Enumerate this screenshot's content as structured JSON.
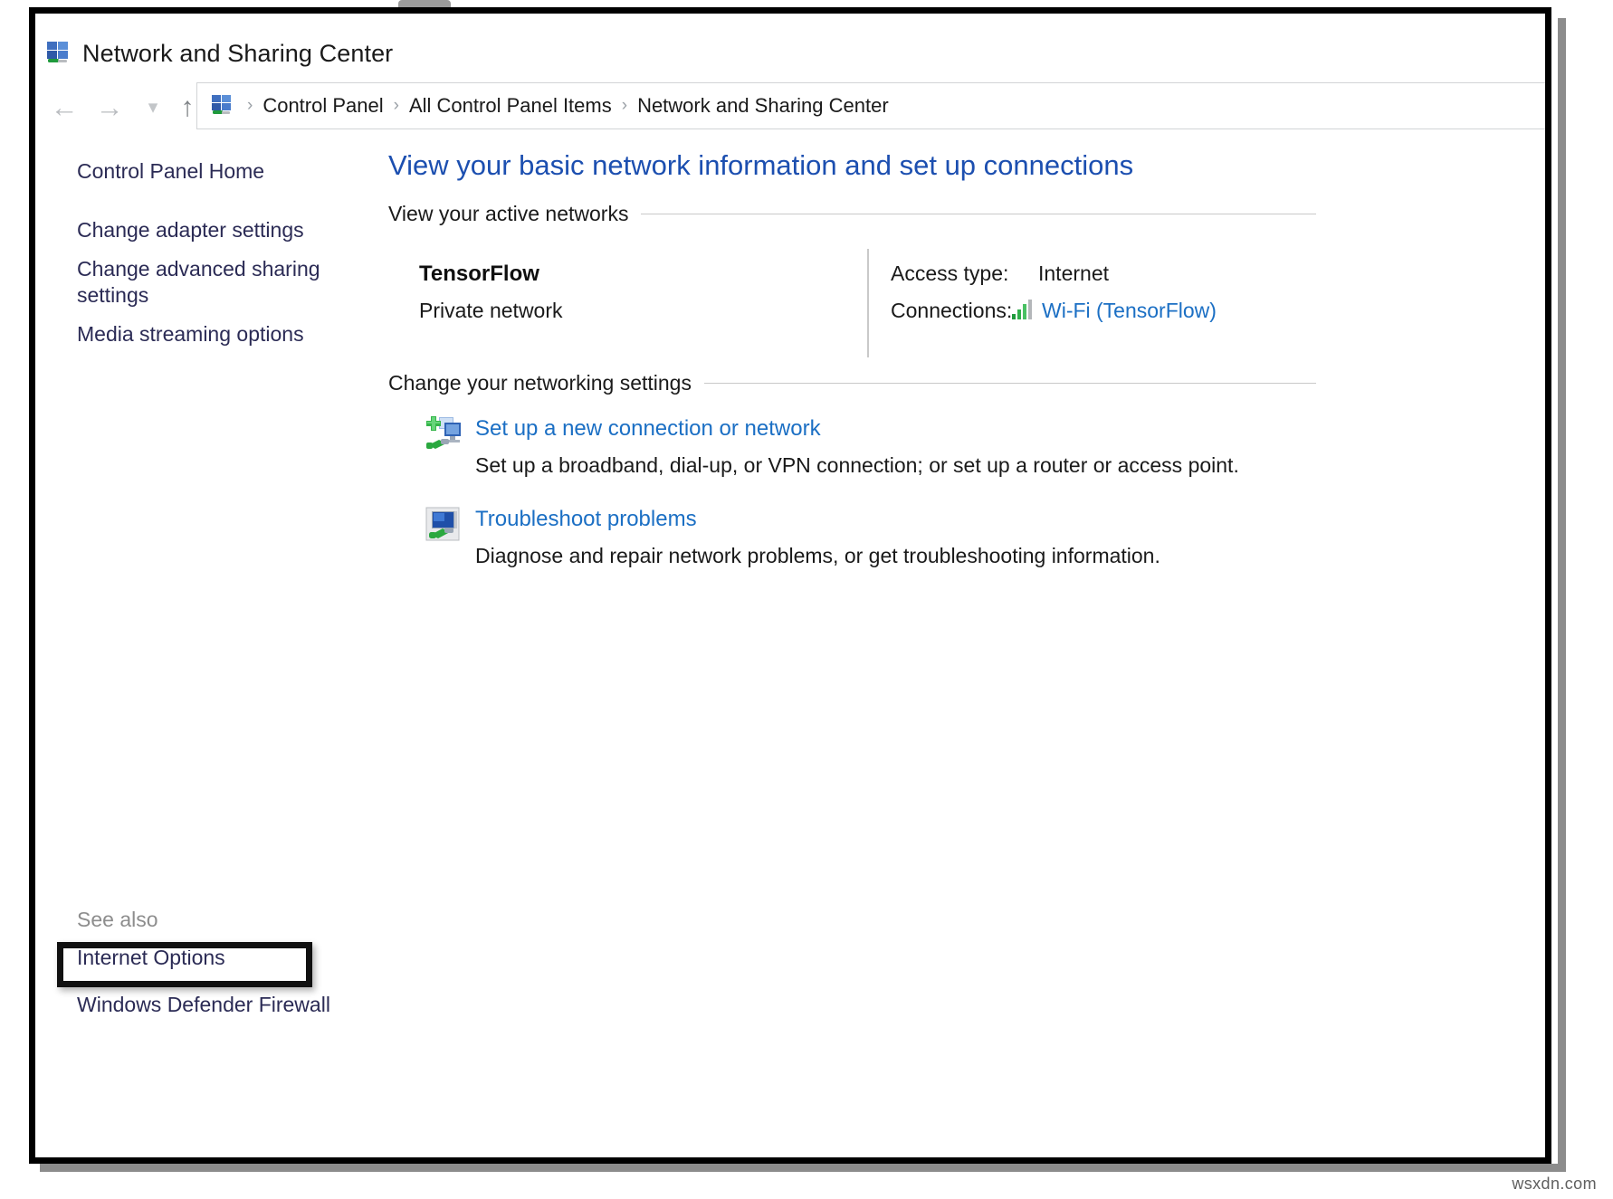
{
  "window": {
    "title": "Network and Sharing Center",
    "icon": "network-sharing-icon"
  },
  "navigation": {
    "back_icon": "arrow-left-icon",
    "forward_icon": "arrow-right-icon",
    "recent_icon": "chevron-down-icon",
    "up_icon": "arrow-up-icon",
    "breadcrumb_icon": "network-sharing-icon",
    "breadcrumb": [
      "Control Panel",
      "All Control Panel Items",
      "Network and Sharing Center"
    ],
    "separator": "›"
  },
  "sidebar": {
    "links": [
      {
        "label": "Control Panel Home"
      },
      {
        "label": "Change adapter settings"
      },
      {
        "label": "Change advanced sharing settings"
      },
      {
        "label": "Media streaming options"
      }
    ],
    "see_also": {
      "label": "See also",
      "links": [
        {
          "label": "Internet Options",
          "highlighted": true
        },
        {
          "label": "Windows Defender Firewall",
          "highlighted": false
        }
      ]
    }
  },
  "main": {
    "heading": "View your basic network information and set up connections",
    "sections": {
      "active_networks": {
        "title": "View your active networks",
        "network": {
          "name": "TensorFlow",
          "type": "Private network",
          "access_type_label": "Access type:",
          "access_type_value": "Internet",
          "connections_label": "Connections:",
          "connections_value": "Wi-Fi (TensorFlow)",
          "connections_icon": "wifi-signal-icon"
        }
      },
      "networking_settings": {
        "title": "Change your networking settings",
        "tasks": [
          {
            "icon": "new-connection-icon",
            "link": "Set up a new connection or network",
            "description": "Set up a broadband, dial-up, or VPN connection; or set up a router or access point."
          },
          {
            "icon": "troubleshoot-icon",
            "link": "Troubleshoot problems",
            "description": "Diagnose and repair network problems, or get troubleshooting information."
          }
        ]
      }
    }
  },
  "watermark": "wsxdn.com",
  "colors": {
    "heading_blue": "#1c4fb0",
    "link_blue": "#1b6fc4",
    "sidebar_link": "#2b2b55",
    "see_also_label": "#8d8d8d",
    "annotation": "#111111"
  }
}
